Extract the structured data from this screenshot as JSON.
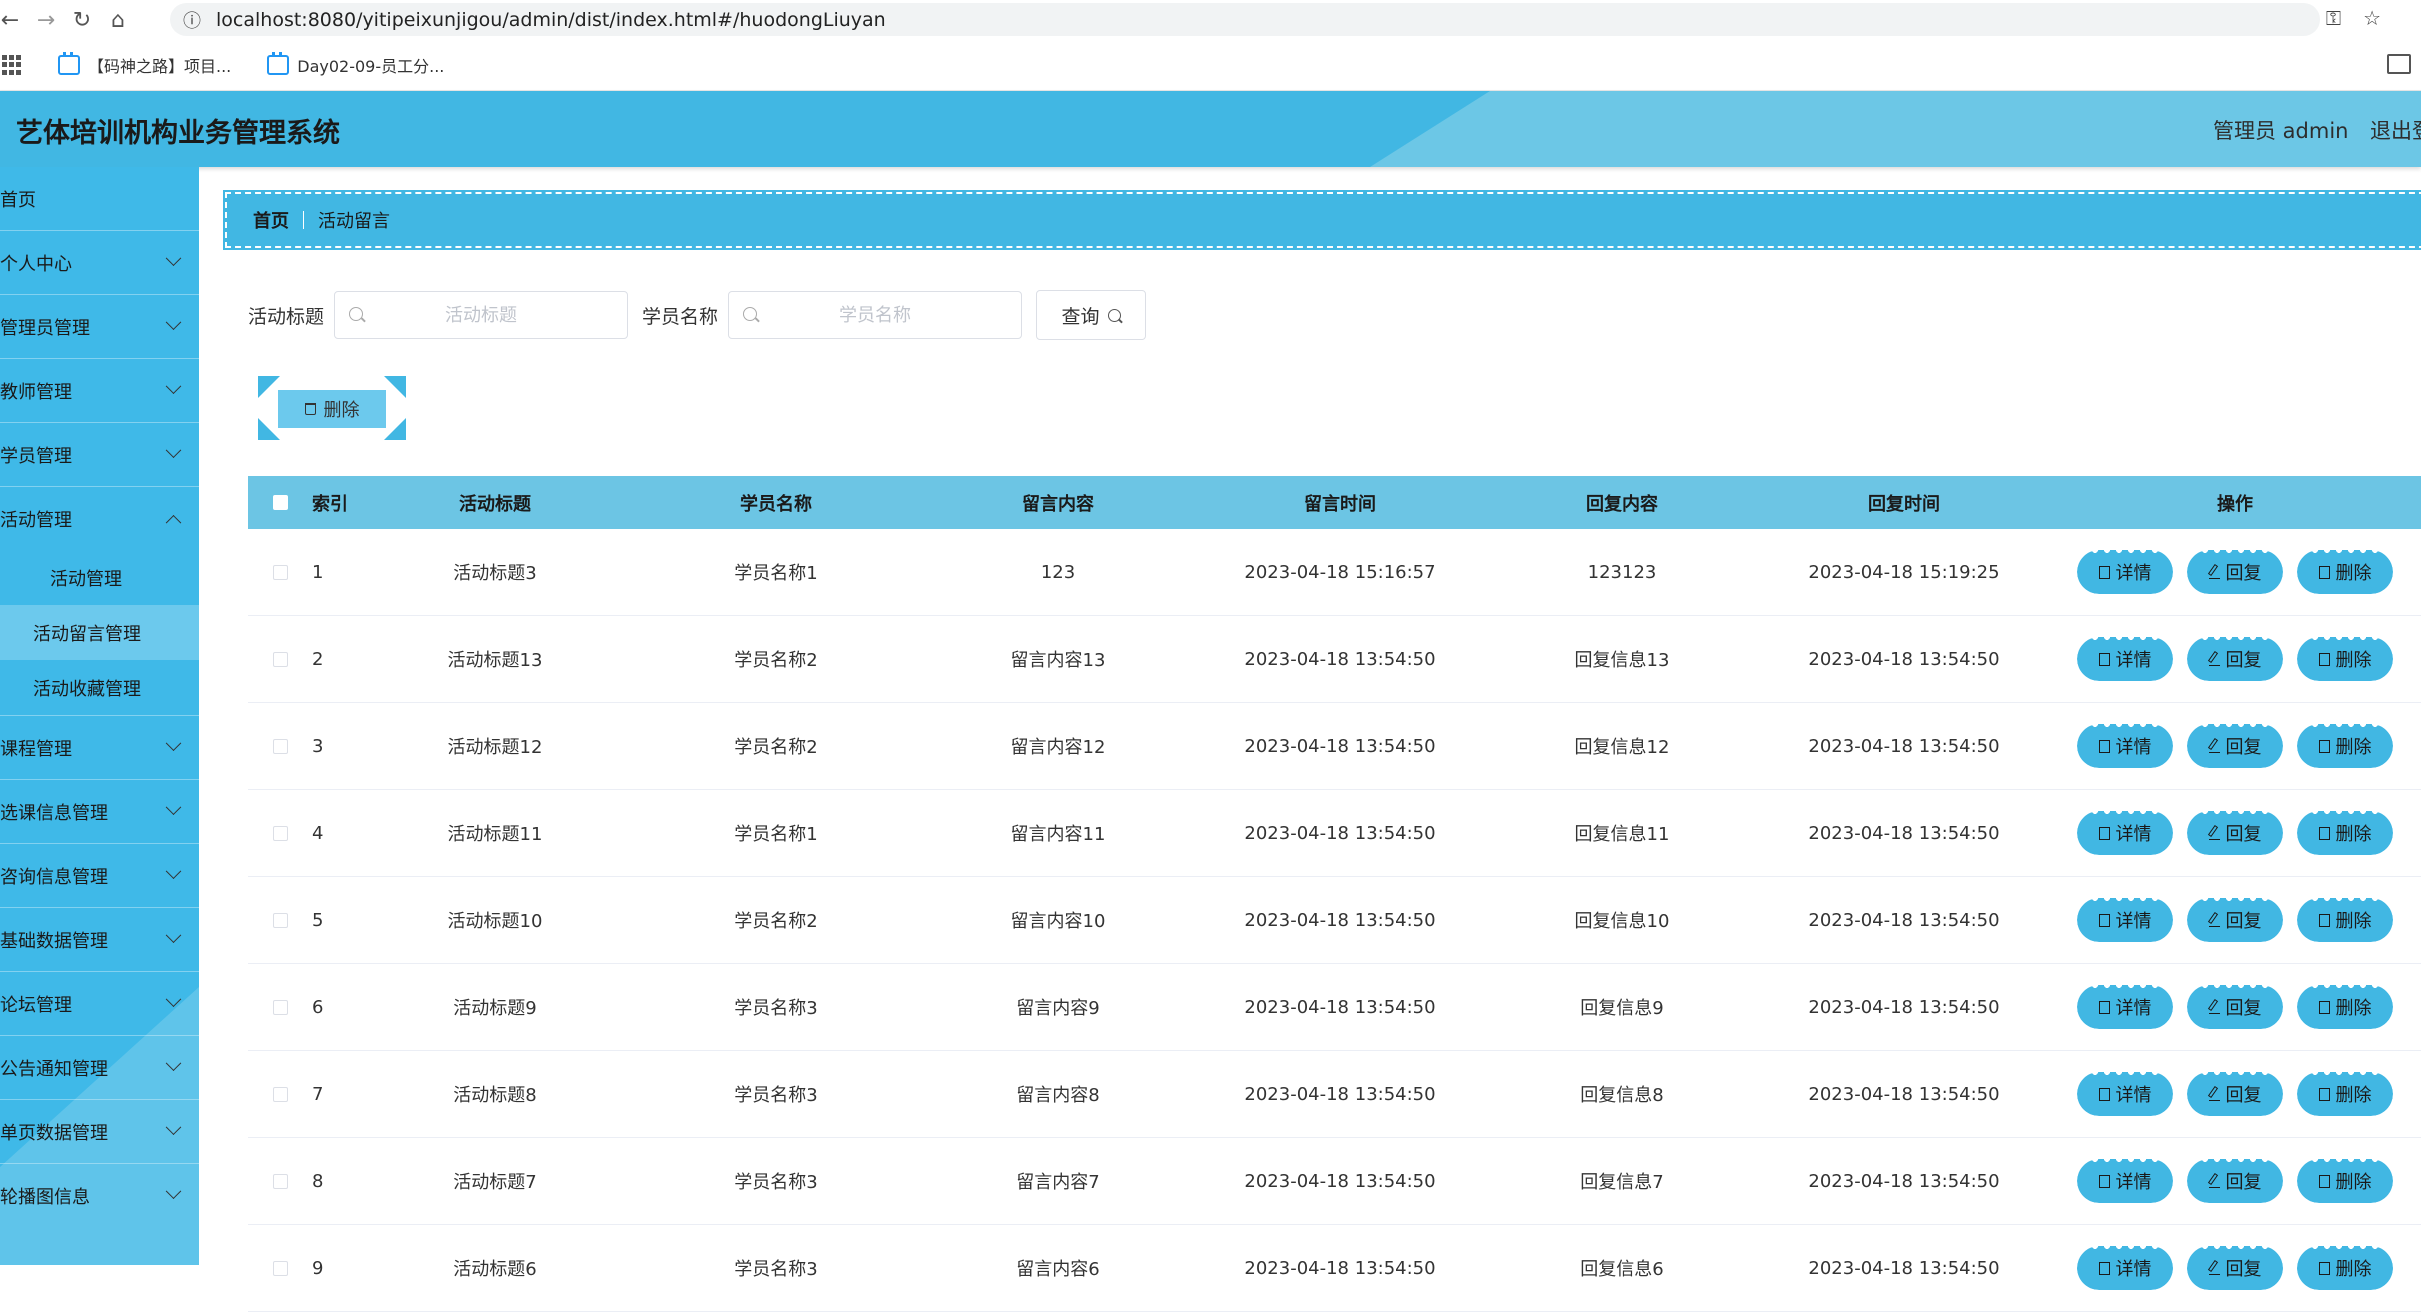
{
  "browser": {
    "url": "localhost:8080/yitipeixunjigou/admin/dist/index.html#/huodongLiuyan",
    "bookmarks": [
      "【码神之路】项目...",
      "Day02-09-员工分..."
    ]
  },
  "header": {
    "title": "艺体培训机构业务管理系统",
    "user": "管理员 admin",
    "logout": "退出登"
  },
  "sidebar": {
    "items": [
      {
        "label": "首页"
      },
      {
        "label": "个人中心"
      },
      {
        "label": "管理员管理"
      },
      {
        "label": "教师管理"
      },
      {
        "label": "学员管理"
      },
      {
        "label": "活动管理"
      },
      {
        "label": "活动管理"
      },
      {
        "label": "活动留言管理"
      },
      {
        "label": "活动收藏管理"
      },
      {
        "label": "课程管理"
      },
      {
        "label": "选课信息管理"
      },
      {
        "label": "咨询信息管理"
      },
      {
        "label": "基础数据管理"
      },
      {
        "label": "论坛管理"
      },
      {
        "label": "公告通知管理"
      },
      {
        "label": "单页数据管理"
      },
      {
        "label": "轮播图信息"
      }
    ]
  },
  "breadcrumb": {
    "home": "首页",
    "current": "活动留言"
  },
  "search": {
    "title_label": "活动标题",
    "title_placeholder": "活动标题",
    "student_label": "学员名称",
    "student_placeholder": "学员名称",
    "query_label": "查询"
  },
  "batch_delete": "删除",
  "table": {
    "headers": [
      "索引",
      "活动标题",
      "学员名称",
      "留言内容",
      "留言时间",
      "回复内容",
      "回复时间",
      "操作"
    ],
    "ops": {
      "detail": "详情",
      "reply": "回复",
      "delete": "删除"
    },
    "rows": [
      [
        "1",
        "活动标题3",
        "学员名称1",
        "123",
        "2023-04-18 15:16:57",
        "123123",
        "2023-04-18 15:19:25"
      ],
      [
        "2",
        "活动标题13",
        "学员名称2",
        "留言内容13",
        "2023-04-18 13:54:50",
        "回复信息13",
        "2023-04-18 13:54:50"
      ],
      [
        "3",
        "活动标题12",
        "学员名称2",
        "留言内容12",
        "2023-04-18 13:54:50",
        "回复信息12",
        "2023-04-18 13:54:50"
      ],
      [
        "4",
        "活动标题11",
        "学员名称1",
        "留言内容11",
        "2023-04-18 13:54:50",
        "回复信息11",
        "2023-04-18 13:54:50"
      ],
      [
        "5",
        "活动标题10",
        "学员名称2",
        "留言内容10",
        "2023-04-18 13:54:50",
        "回复信息10",
        "2023-04-18 13:54:50"
      ],
      [
        "6",
        "活动标题9",
        "学员名称3",
        "留言内容9",
        "2023-04-18 13:54:50",
        "回复信息9",
        "2023-04-18 13:54:50"
      ],
      [
        "7",
        "活动标题8",
        "学员名称3",
        "留言内容8",
        "2023-04-18 13:54:50",
        "回复信息8",
        "2023-04-18 13:54:50"
      ],
      [
        "8",
        "活动标题7",
        "学员名称3",
        "留言内容7",
        "2023-04-18 13:54:50",
        "回复信息7",
        "2023-04-18 13:54:50"
      ],
      [
        "9",
        "活动标题6",
        "学员名称3",
        "留言内容6",
        "2023-04-18 13:54:50",
        "回复信息6",
        "2023-04-18 13:54:50"
      ]
    ]
  },
  "colors": {
    "primary": "#41b7e3",
    "header_row": "#6cc5e4",
    "active_menu": "#6cc9ed"
  }
}
